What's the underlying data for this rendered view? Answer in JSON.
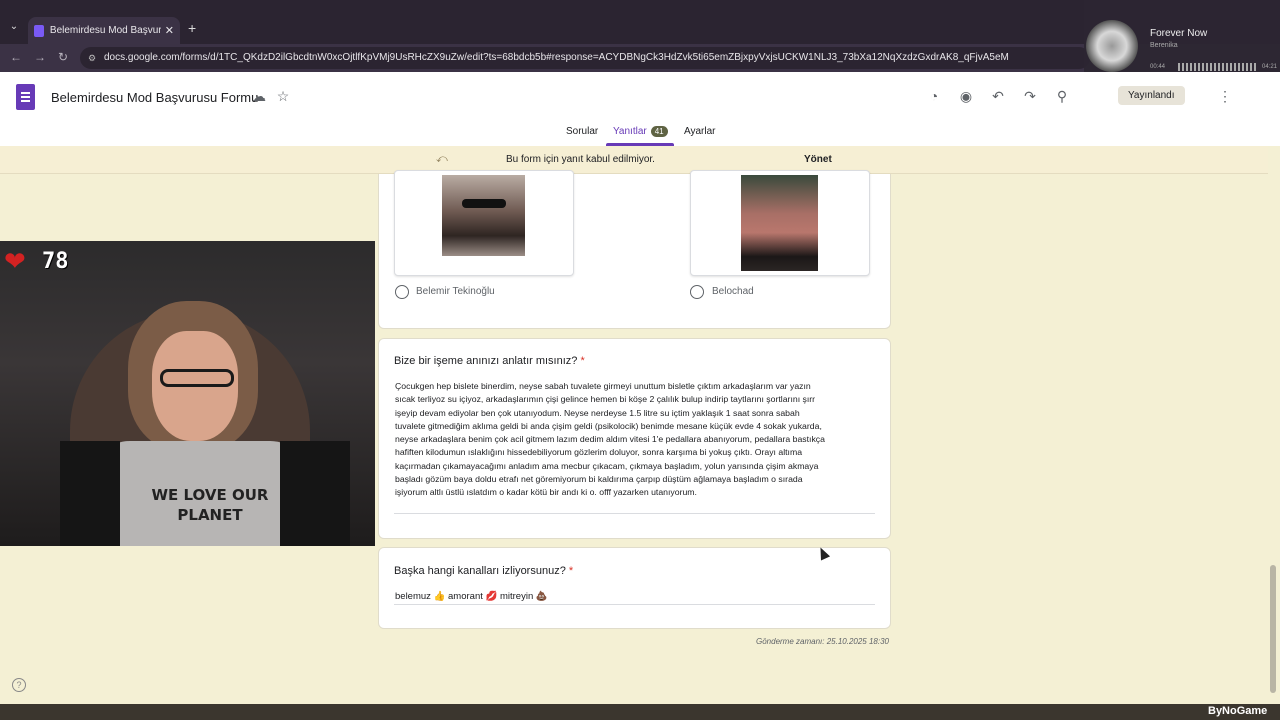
{
  "browser": {
    "tab_title": "Belemirdesu Mod Başvurusu Fo",
    "tab_close": "✕",
    "new_tab": "+",
    "tab_list": "⌄",
    "url": "docs.google.com/forms/d/1TC_QKdzD2ilGbcdtnW0xcOjtlfKpVMj9UsRHcZX9uZw/edit?ts=68bdcb5b#response=ACYDBNgCk3HdZvk5ti65emZBjxpyVxjsUCKW1NLJ3_73bXa12NqXzdzGxdrAK8_qFjvA5eM",
    "back": "←",
    "forward": "→",
    "reload": "↻",
    "lock": "⚙"
  },
  "header": {
    "title": "Belemirdesu Mod Başvurusu Formu",
    "icons": {
      "drive": "☁",
      "star": "☆",
      "palette": "◔",
      "preview": "◉",
      "undo": "↶",
      "redo": "↷",
      "link": "⚲",
      "more": "⋮"
    },
    "publish_label": "Yayınlandı",
    "tabs": {
      "questions": "Sorular",
      "responses": "Yanıtlar",
      "responses_count": "41",
      "settings": "Ayarlar"
    }
  },
  "notice": {
    "icon": "⤺",
    "text": "Bu form için yanıt kabul edilmiyor.",
    "action": "Yönet"
  },
  "image_question": {
    "options": [
      {
        "label": "Belemir Tekinoğlu"
      },
      {
        "label": "Belochad"
      }
    ]
  },
  "story_question": {
    "title": "Bize bir işeme anınızı anlatır mısınız?",
    "required_mark": "*",
    "answer_lines": [
      "Çocukgen hep bislete binerdim, neyse sabah tuvalete girmeyi unuttum bisletle çıktım arkadaşlarım var yazın",
      "sıcak terliyoz su içiyoz, arkadaşlarımın çişi gelince hemen bi köşe 2 çalılık bulup indirip taytlarını şortlarını şırr",
      "işeyip devam ediyolar ben çok utanıyodum. Neyse nerdeyse 1.5 litre su içtim yaklaşık 1 saat sonra sabah",
      "tuvalete gitmediğim aklıma geldi bi anda çişim geldi (psikolocik) benimde mesane küçük  evde 4 sokak yukarda,",
      "neyse arkadaşlara benim çok acil gitmem lazım dedim aldım vitesi 1'e pedallara abanıyorum, pedallara bastıkça",
      "hafiften kilodumun ıslaklığını hissedebiliyorum gözlerim doluyor, sonra karşıma bi yokuş çıktı. Orayı altıma",
      "kaçırmadan çıkamayacağımı anladım ama mecbur çıkacam, çıkmaya başladım, yolun yarısında çişim akmaya",
      "başladı gözüm baya doldu etrafı net göremiyorum bi kaldırıma çarpıp düştüm ağlamaya başladım o sırada",
      "işiyorum altlı üstlü ıslatdım o kadar kötü bir andı ki o. offf yazarken utanıyorum."
    ]
  },
  "channels_question": {
    "title": "Başka hangi kanalları izliyorsunuz?",
    "required_mark": "*",
    "answer": "belemuz 👍 amorant 💋 mitreyin 💩"
  },
  "footer": {
    "submitted": "Gönderme zamanı: 25.10.2025 18:30",
    "help": "?"
  },
  "overlay": {
    "hp_heart": "❤",
    "hp_value": "78",
    "shirt_text": "WE LOVE OUR PLANET",
    "music_title": "Forever Now",
    "music_artist": "Berenika",
    "music_time_elapsed": "00:44",
    "music_time_total": "04:21",
    "watermark": "ByNoGame"
  },
  "colors": {
    "accent": "#673ab7",
    "page_bg": "#f4f0d4",
    "required": "#d93025"
  }
}
